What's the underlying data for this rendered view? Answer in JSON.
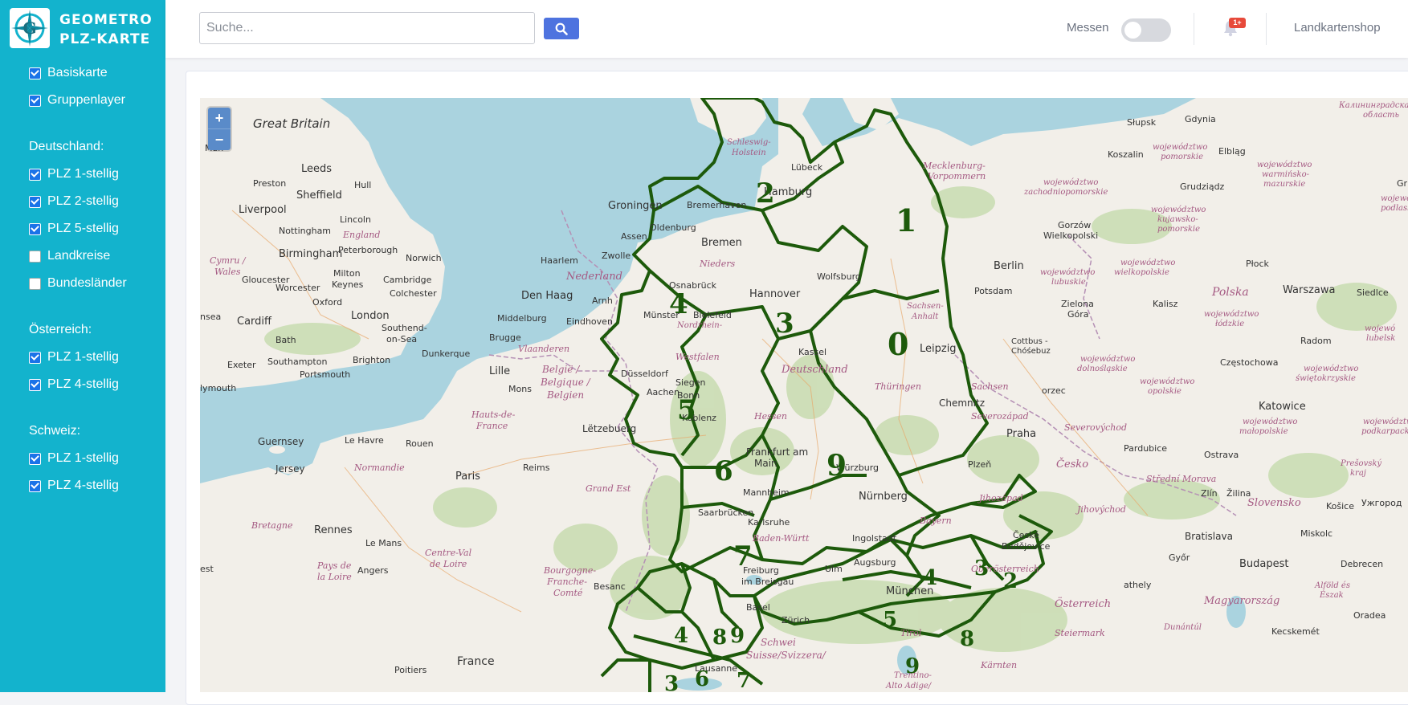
{
  "brand": {
    "line1": "GEOMETRO",
    "line2": "PLZ-KARTE",
    "logo_icon": "compass-logo-icon"
  },
  "sidebar": {
    "top_layers": [
      {
        "label": "Basiskarte",
        "checked": true
      },
      {
        "label": "Gruppenlayer",
        "checked": true
      }
    ],
    "sections": [
      {
        "title": "Deutschland:",
        "items": [
          {
            "label": "PLZ 1-stellig",
            "checked": true
          },
          {
            "label": "PLZ 2-stellig",
            "checked": true
          },
          {
            "label": "PLZ 5-stellig",
            "checked": true
          },
          {
            "label": "Landkreise",
            "checked": false
          },
          {
            "label": "Bundesländer",
            "checked": false
          }
        ]
      },
      {
        "title": "Österreich:",
        "items": [
          {
            "label": "PLZ 1-stellig",
            "checked": true
          },
          {
            "label": "PLZ 4-stellig",
            "checked": true
          }
        ]
      },
      {
        "title": "Schweiz:",
        "items": [
          {
            "label": "PLZ 1-stellig",
            "checked": true
          },
          {
            "label": "PLZ 4-stellig",
            "checked": true
          }
        ]
      }
    ]
  },
  "topbar": {
    "search_placeholder": "Suche...",
    "search_icon": "search-icon",
    "measure_label": "Messen",
    "measure_on": false,
    "notification_badge": "1+",
    "shop_link": "Landkartenshop"
  },
  "map": {
    "zoom_in": "+",
    "zoom_out": "−",
    "plz_regions_de": [
      "0",
      "1",
      "2",
      "3",
      "4",
      "5",
      "6",
      "7",
      "9"
    ],
    "plz_regions_at": [
      "3",
      "4",
      "5",
      "8",
      "9",
      "2"
    ],
    "plz_regions_ch": [
      "4",
      "8",
      "9",
      "3",
      "6",
      "7"
    ],
    "places": {
      "great_britain": "Great Britain",
      "leeds": "Leeds",
      "preston": "Preston",
      "hull": "Hull",
      "sheffield": "Sheffield",
      "liverpool": "Liverpool",
      "lincoln": "Lincoln",
      "nottingham": "Nottingham",
      "england": "England",
      "birmingham": "Birmingham",
      "peterborough": "Peterborough",
      "norwich": "Norwich",
      "cymru": "Cymru /",
      "wales": "Wales",
      "milton_keynes_1": "Milton",
      "milton_keynes_2": "Keynes",
      "cambridge": "Cambridge",
      "colchester": "Colchester",
      "gloucester": "Gloucester",
      "worcester": "Worcester",
      "oxford": "Oxford",
      "cardiff": "Cardiff",
      "london": "London",
      "bath": "Bath",
      "southend_1": "Southend-",
      "southend_2": "on-Sea",
      "exeter": "Exeter",
      "southampton": "Southampton",
      "brighton": "Brighton",
      "portsmouth": "Portsmouth",
      "plymouth": "lymouth",
      "ansea": "nsea",
      "man": "Man",
      "groningen": "Groningen",
      "assen": "Assen",
      "zwolle": "Zwolle",
      "haarlem": "Haarlem",
      "nederland": "Nederland",
      "den_haag": "Den Haag",
      "arnhem": "Arnh",
      "middelburg": "Middelburg",
      "eindhoven": "Eindhoven",
      "brugge": "Brugge",
      "dunkerque": "Dunkerque",
      "vlaanderen": "Vlaanderen",
      "lille": "Lille",
      "belgie_1": "België /",
      "belgie_2": "Belgique /",
      "belgie_3": "Belgien",
      "mons": "Mons",
      "hauts_1": "Hauts-de-",
      "hauts_2": "France",
      "letzebuerg": "Lëtzebuerg",
      "guernsey": "Guernsey",
      "jersey": "Jersey",
      "le_havre": "Le Havre",
      "rouen": "Rouen",
      "normandie": "Normandie",
      "paris": "Paris",
      "reims": "Reims",
      "grand_est": "Grand Est",
      "bretagne": "Bretagne",
      "rennes": "Rennes",
      "le_mans": "Le Mans",
      "pays_1": "Pays de",
      "pays_2": "la Loire",
      "angers": "Angers",
      "centre_1": "Centre-Val",
      "centre_2": "de Loire",
      "bourgogne_1": "Bourgogne-",
      "bourgogne_2": "Franche-",
      "bourgogne_3": "Comté",
      "besancon": "Besanc",
      "poitiers": "Poitiers",
      "france": "France",
      "est": "est",
      "schleswig_1": "Schleswig-",
      "schleswig_2": "Holstein",
      "lubeck": "Lübeck",
      "hamburg": "Hamburg",
      "bremerhaven": "Bremerhaven",
      "oldenburg": "Oldenburg",
      "bremen": "Bremen",
      "niedersachsen": "Nieders",
      "osnabruck": "Osnabrück",
      "hannover": "Hannover",
      "wolfsburg": "Wolfsburg",
      "bielefeld": "Bielefeld",
      "munster": "Münster",
      "nordrhein_1": "Nordrhein-",
      "westfalen": "Westfalen",
      "dusseldorf": "Düsseldorf",
      "kassel": "Kassel",
      "deutschland": "Deutschland",
      "siegen": "Siegen",
      "aachen": "Aachen",
      "bonn": "Bonn",
      "koblenz": "Koblenz",
      "hessen": "Hessen",
      "frankfurt": "Frankfurt am",
      "main": "Main",
      "mannheim": "Mannheim",
      "saarbrucken": "Saarbrücken",
      "wurzburg": "Würzburg",
      "nurnberg": "Nürnberg",
      "karlsruhe": "Karlsruhe",
      "baden": "Baden-Württ",
      "ingolstadt": "Ingolstadt",
      "augsburg": "Augsburg",
      "ulm": "Ulm",
      "munchen": "München",
      "bayern": "Bayern",
      "freiburg_1": "Freiburg",
      "freiburg_2": "im Breisgau",
      "basel": "Basel",
      "zurich": "Zürich",
      "schweiz": "Schwei",
      "suisse": "Suisse/Svizzera/",
      "lausanne": "Lausanne",
      "tirol": "Tirol",
      "trentino_1": "Trentino-",
      "trentino_2": "Alto Adige/",
      "mecklenburg_1": "Mecklenburg-",
      "mecklenburg_2": "Vorpommern",
      "berlin": "Berlin",
      "potsdam": "Potsdam",
      "sachsen_anhalt_1": "Sachsen-",
      "sachsen_anhalt_2": "Anhalt",
      "leipzig": "Leipzig",
      "sachsen": "Sachsen",
      "thuringen": "Thüringen",
      "chemnitz": "Chemnitz",
      "cottbus_1": "Cottbus -",
      "cottbus_2": "Chóśebuz",
      "zgorzelec": "orzec",
      "severozapad": "Severozápad",
      "praha": "Praha",
      "plzen": "Plzeň",
      "cesko": "Česko",
      "jihozapad": "Jihozápad",
      "ceske_1": "České",
      "ceske_2": "Budějovice",
      "oberosterreich": "Oberösterreich",
      "osterreich": "Österreich",
      "steiermark": "Steiermark",
      "karnten": "Kärnten",
      "severovychod": "Severovýchod",
      "pardubice": "Pardubice",
      "jihovychod": "Jihovýchod",
      "stredni_morava": "Střední Morava",
      "ostrava": "Ostrava",
      "zlin": "Zlín",
      "zilina": "Žilina",
      "slupsk": "Słupsk",
      "gdynia": "Gdynia",
      "elblag": "Elbląg",
      "koszalin": "Koszalin",
      "pomorskie_1": "województwo",
      "pomorskie_2": "pomorskie",
      "zach_1": "województwo",
      "zach_2": "zachodniopomorskie",
      "warm_1": "województwo",
      "warm_2": "warmińsko-",
      "warm_3": "mazurskie",
      "grudziadz": "Grudziądz",
      "gorzow_1": "Gorzów",
      "gorzow_2": "Wielkopolski",
      "kuj_1": "województwo",
      "kuj_2": "kujawsko-",
      "kuj_3": "pomorskie",
      "wlkp_1": "województwo",
      "wlkp_2": "wielkopolskie",
      "plock": "Płock",
      "lub_1": "województwo",
      "lub_2": "lubuskie",
      "polska": "Polska",
      "warszawa": "Warszawa",
      "siedlce": "Siedlce",
      "zielona_1": "Zielona",
      "zielona_2": "Góra",
      "kalisz": "Kalisz",
      "lodz_1": "województwo",
      "lodz_2": "łódzkie",
      "radom": "Radom",
      "dolno_1": "województwo",
      "dolno_2": "dolnośląskie",
      "opol_1": "województwo",
      "opol_2": "opolskie",
      "czestochowa": "Częstochowa",
      "swiet_1": "województwo",
      "swiet_2": "świętokrzyskie",
      "lubel_1": "wojewó",
      "lubel_2": "lubelsk",
      "katowice": "Katowice",
      "malo_1": "województwo",
      "malo_2": "małopolskie",
      "podk_1": "województwo",
      "podk_2": "podkarpackie",
      "presov_1": "Prešovský",
      "presov_2": "kraj",
      "slovensko": "Slovensko",
      "kosice": "Košice",
      "uzhorod": "Ужгород",
      "bratislava": "Bratislava",
      "gyor": "Győr",
      "miskolc": "Miskolc",
      "budapest": "Budapest",
      "debrecen": "Debrecen",
      "magyarorszag": "Magyarország",
      "alfold_1": "Alföld és",
      "alfold_2": "Észak",
      "dunantul": "Dunántúl",
      "szombathely": "athely",
      "kecskemet": "Kecskemét",
      "oradea": "Oradea",
      "kaliningrad_1": "Калининградская",
      "kaliningrad_2": "область",
      "gr": "Gr",
      "podlas_1": "wojewó",
      "podlas_2": "podlask"
    }
  },
  "colors": {
    "sidebar_bg": "#13b3cd",
    "accent_blue": "#4e73df",
    "checkbox_blue": "#1a73e8",
    "badge_red": "#e74a3b",
    "plz_border": "#1d5a0b",
    "sea": "#aad3df",
    "land": "#f2efe9",
    "forest": "#c8dcb0"
  }
}
